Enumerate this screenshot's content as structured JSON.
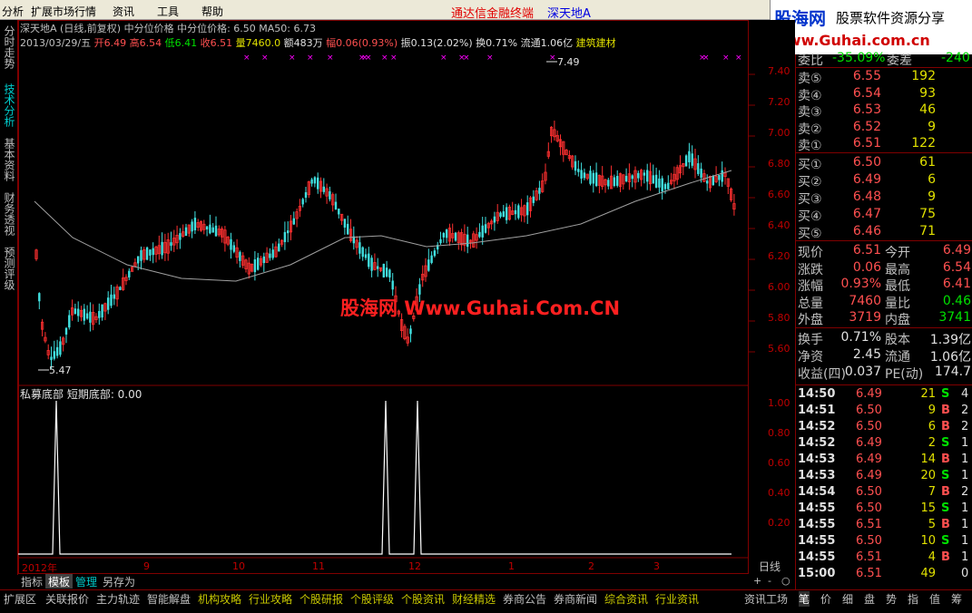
{
  "menu": {
    "items": [
      "分析",
      "扩展市场行情",
      "资讯",
      "工具",
      "帮助"
    ],
    "app_title": "通达信金融终端",
    "stock_title": "深天地A"
  },
  "logo": {
    "brand": "股海网",
    "slogan": "股票软件资源分享",
    "url": "www.Guhai.com.cn"
  },
  "left_tabs": [
    "分时走势",
    "技术分析",
    "基本资料",
    "财务透视",
    "预测评级"
  ],
  "header": {
    "line1": "深天地A (日线,前复权) 中分位价格  中分位价格: 6.50  MA50: 6.73",
    "date": "2013/03/29/五",
    "open_label": "开",
    "open": "6.49",
    "high_label": "高",
    "high": "6.54",
    "low_label": "低",
    "low": "6.41",
    "close_label": "收",
    "close": "6.51",
    "vol_label": "量",
    "vol": "7460.0",
    "amt_label": "额",
    "amt": "483万",
    "pct_label": "幅",
    "pct": "0.06(0.93%)",
    "amp": "振0.13(2.02%)",
    "turn": "换0.71%",
    "float": "流通1.06亿",
    "industry": "建筑建材"
  },
  "watermark": "股海网 Www.Guhai.Com.CN",
  "annotations": {
    "high_mark": "7.49",
    "low_mark": "5.47"
  },
  "indicator": {
    "title": "私募底部  短期底部: 0.00"
  },
  "price_axis": [
    "7.40",
    "7.20",
    "7.00",
    "6.80",
    "6.60",
    "6.40",
    "6.20",
    "6.00",
    "5.80",
    "5.60"
  ],
  "ind_axis": [
    "1.00",
    "0.80",
    "0.60",
    "0.40",
    "0.20"
  ],
  "time_axis": [
    "2012年",
    "9",
    "10",
    "11",
    "12",
    "1",
    "2",
    "3"
  ],
  "bottom_tabs": [
    "指标",
    "模板",
    "管理",
    "另存为"
  ],
  "day_line": "日线",
  "zoom": [
    "+",
    "-",
    "○"
  ],
  "status_bar": [
    "扩展区",
    "关联报价",
    "主力轨迹",
    "智能解盘",
    "机构攻略",
    "行业攻略",
    "个股研报",
    "个股评级",
    "个股资讯",
    "财经精选",
    "券商公告",
    "券商新闻",
    "综合资讯",
    "行业资讯",
    "资讯工场"
  ],
  "quote": {
    "weibi_label": "委比",
    "weibi": "-35.09%",
    "weicha_label": "委差",
    "weicha": "-240",
    "sell": [
      {
        "label": "卖⑤",
        "price": "6.55",
        "vol": "192"
      },
      {
        "label": "卖④",
        "price": "6.54",
        "vol": "93"
      },
      {
        "label": "卖③",
        "price": "6.53",
        "vol": "46"
      },
      {
        "label": "卖②",
        "price": "6.52",
        "vol": "9"
      },
      {
        "label": "卖①",
        "price": "6.51",
        "vol": "122"
      }
    ],
    "buy": [
      {
        "label": "买①",
        "price": "6.50",
        "vol": "61"
      },
      {
        "label": "买②",
        "price": "6.49",
        "vol": "6"
      },
      {
        "label": "买③",
        "price": "6.48",
        "vol": "9"
      },
      {
        "label": "买④",
        "price": "6.47",
        "vol": "75"
      },
      {
        "label": "买⑤",
        "price": "6.46",
        "vol": "71"
      }
    ],
    "stats": [
      {
        "l1": "现价",
        "v1": "6.51",
        "l2": "今开",
        "v2": "6.49"
      },
      {
        "l1": "涨跌",
        "v1": "0.06",
        "l2": "最高",
        "v2": "6.54"
      },
      {
        "l1": "涨幅",
        "v1": "0.93%",
        "l2": "最低",
        "v2": "6.41"
      },
      {
        "l1": "总量",
        "v1": "7460",
        "l2": "量比",
        "v2": "0.46"
      },
      {
        "l1": "外盘",
        "v1": "3719",
        "l2": "内盘",
        "v2": "3741"
      }
    ],
    "fin": [
      {
        "l1": "换手",
        "v1": "0.71%",
        "l2": "股本",
        "v2": "1.39亿"
      },
      {
        "l1": "净资",
        "v1": "2.45",
        "l2": "流通",
        "v2": "1.06亿"
      },
      {
        "l1": "收益(四)",
        "v1": "0.037",
        "l2": "PE(动)",
        "v2": "174.7"
      }
    ]
  },
  "ticks": [
    {
      "time": "14:50",
      "price": "6.49",
      "vol": "21",
      "side": "S",
      "n": "4"
    },
    {
      "time": "14:51",
      "price": "6.50",
      "vol": "9",
      "side": "B",
      "n": "2"
    },
    {
      "time": "14:52",
      "price": "6.50",
      "vol": "6",
      "side": "B",
      "n": "2"
    },
    {
      "time": "14:52",
      "price": "6.49",
      "vol": "2",
      "side": "S",
      "n": "1"
    },
    {
      "time": "14:53",
      "price": "6.49",
      "vol": "14",
      "side": "B",
      "n": "1"
    },
    {
      "time": "14:53",
      "price": "6.49",
      "vol": "20",
      "side": "S",
      "n": "1"
    },
    {
      "time": "14:54",
      "price": "6.50",
      "vol": "7",
      "side": "B",
      "n": "2"
    },
    {
      "time": "14:55",
      "price": "6.50",
      "vol": "15",
      "side": "S",
      "n": "1"
    },
    {
      "time": "14:55",
      "price": "6.51",
      "vol": "5",
      "side": "B",
      "n": "1"
    },
    {
      "time": "14:55",
      "price": "6.50",
      "vol": "10",
      "side": "S",
      "n": "1"
    },
    {
      "time": "14:55",
      "price": "6.51",
      "vol": "4",
      "side": "B",
      "n": "1"
    },
    {
      "time": "15:00",
      "price": "6.51",
      "vol": "49",
      "side": "",
      "n": "0"
    }
  ],
  "right_tabs": [
    "笔",
    "价",
    "细",
    "盘",
    "势",
    "指",
    "值",
    "筹"
  ]
}
